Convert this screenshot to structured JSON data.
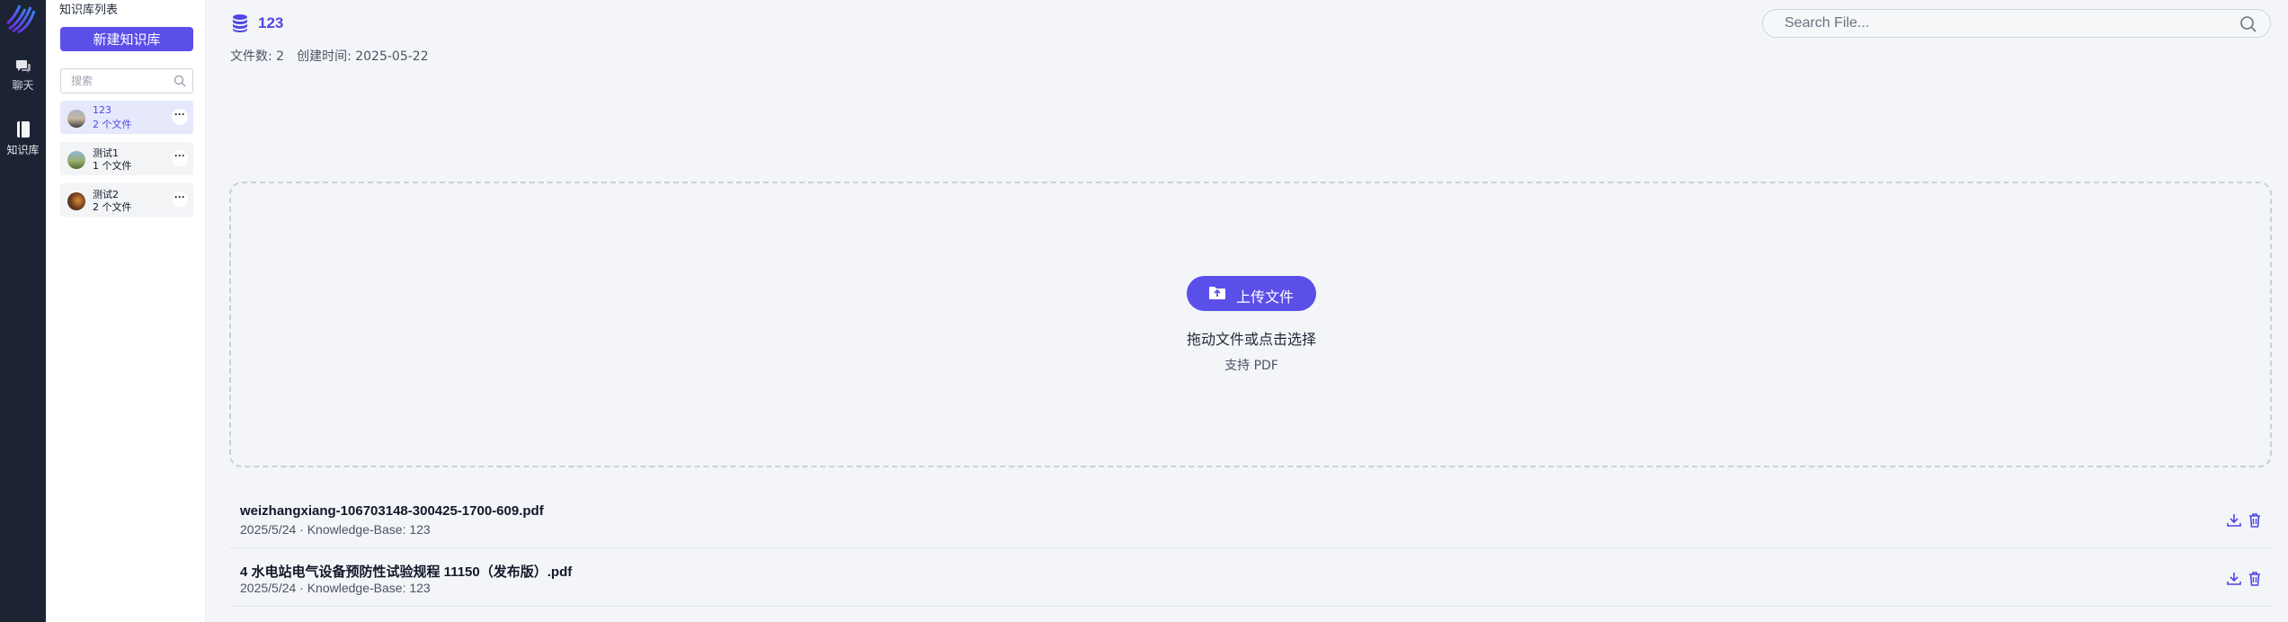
{
  "nav": {
    "chat_label": "聊天",
    "kb_label": "知识库"
  },
  "panel": {
    "title": "知识库列表",
    "new_button": "新建知识库",
    "search_placeholder": "搜索",
    "items": [
      {
        "name": "123",
        "count": "2 个文件",
        "more": "···",
        "active": true
      },
      {
        "name": "测试1",
        "count": "1 个文件",
        "more": "···",
        "active": false
      },
      {
        "name": "测试2",
        "count": "2 个文件",
        "more": "···",
        "active": false
      }
    ]
  },
  "main": {
    "title": "123",
    "file_count": "文件数: 2",
    "created": "创建时间: 2025-05-22",
    "search_placeholder": "Search File...",
    "upload_label": "上传文件",
    "drop_hint": "拖动文件或点击选择",
    "drop_sub": "支持 PDF",
    "files": [
      {
        "name": "weizhangxiang-106703148-300425-1700-609.pdf",
        "meta": "2025/5/24 · Knowledge-Base: 123"
      },
      {
        "name": "4 水电站电气设备预防性试验规程 11150（发布版）.pdf",
        "meta": "2025/5/24 · Knowledge-Base: 123"
      }
    ]
  },
  "colors": {
    "accent": "#5b4fe9",
    "rail": "#1c2434",
    "background": "#f3f5f9"
  },
  "icons": [
    "app-logo-icon",
    "chat-icon",
    "book-icon",
    "search-icon",
    "database-icon",
    "folder-upload-icon",
    "download-icon",
    "trash-icon"
  ]
}
